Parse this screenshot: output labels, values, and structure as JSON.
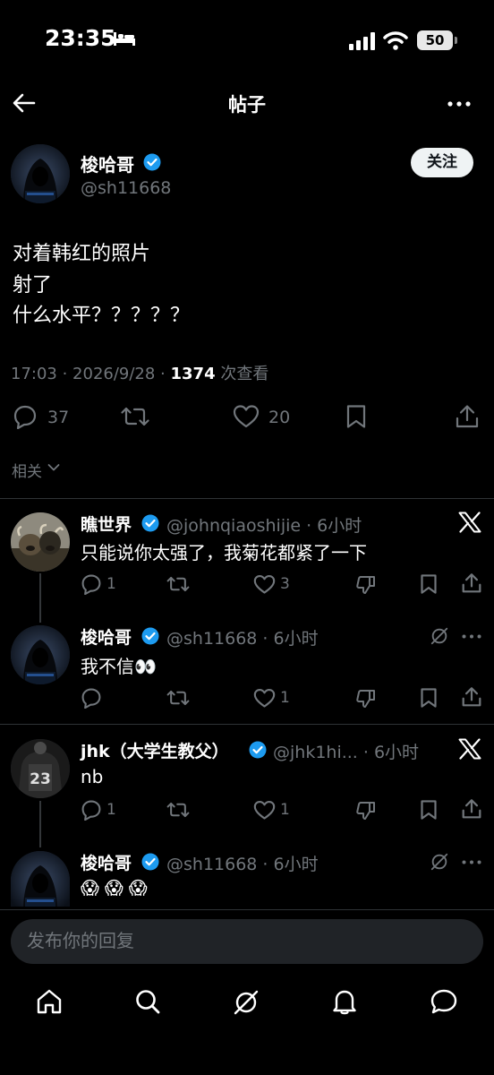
{
  "status_bar": {
    "time": "23:35",
    "battery": "50"
  },
  "nav": {
    "title": "帖子"
  },
  "post": {
    "author_name": "梭哈哥",
    "author_handle": "@sh11668",
    "follow_label": "关注",
    "lines": [
      "对着韩红的照片",
      "射了",
      "什么水平？？？？？"
    ],
    "time": "17:03 · 2026/9/28 · ",
    "views": "1374",
    "views_label": " 次查看",
    "reply_count": "37",
    "like_count": "20",
    "related_label": "相关"
  },
  "replies": [
    {
      "name": "瞧世界",
      "meta": "@johnqiaoshijie · 6小时",
      "text": "只能说你太强了，我菊花都紧了一下",
      "reply_count": "1",
      "like_count": "3"
    },
    {
      "name": "梭哈哥",
      "meta": "@sh11668 · 6小时",
      "text": "我不信👀",
      "like_count": "1"
    },
    {
      "name": "jhk（大学生教父）",
      "meta": "@jhk1hi... · 6小时",
      "text": "nb",
      "reply_count": "1",
      "like_count": "1",
      "avatar_number": "23"
    },
    {
      "name": "梭哈哥",
      "meta": "@sh11668 · 6小时",
      "text": "😱😱😱"
    }
  ],
  "reply_box": {
    "placeholder": "发布你的回复"
  },
  "colors": {
    "background": "#000000",
    "verified": "#1d9bf0",
    "muted": "#71767b"
  }
}
